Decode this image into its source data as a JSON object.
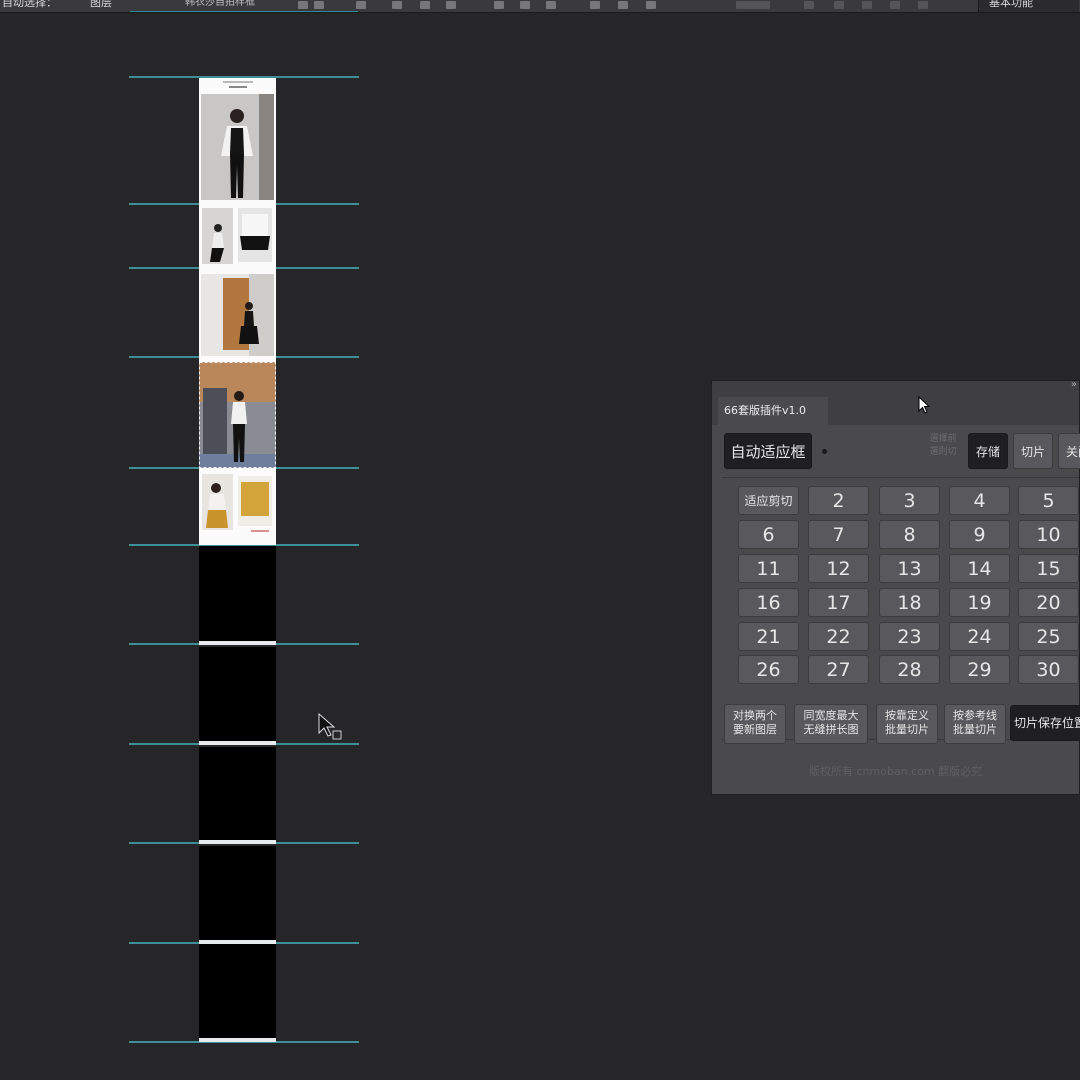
{
  "options_bar": {
    "auto_select_label": "自动选择：",
    "auto_select_value": "图层",
    "workspace_label": "基本功能",
    "document_tab": "韩衣莎自拍样框"
  },
  "panel": {
    "title": "66套版插件v1.0",
    "auto_fit_button": "自动适应框",
    "hint_text": "選擇前\n選則切",
    "top_buttons": [
      "存储",
      "切片",
      "关闭"
    ],
    "grid_first_label": "适应剪切",
    "grid_numbers": [
      "2",
      "3",
      "4",
      "5",
      "6",
      "7",
      "8",
      "9",
      "10",
      "11",
      "12",
      "13",
      "14",
      "15",
      "16",
      "17",
      "18",
      "19",
      "20",
      "21",
      "22",
      "23",
      "24",
      "25",
      "26",
      "27",
      "28",
      "29",
      "30"
    ],
    "bottom_buttons": [
      "对换两个\n要新图层",
      "同宽度最大\n无缝拼长图",
      "按靠定义\n批量切片",
      "按参考线\n批量切片",
      "切片保存位置"
    ],
    "footer_text": "版权所有 cnmoban.com 翻版必究"
  }
}
